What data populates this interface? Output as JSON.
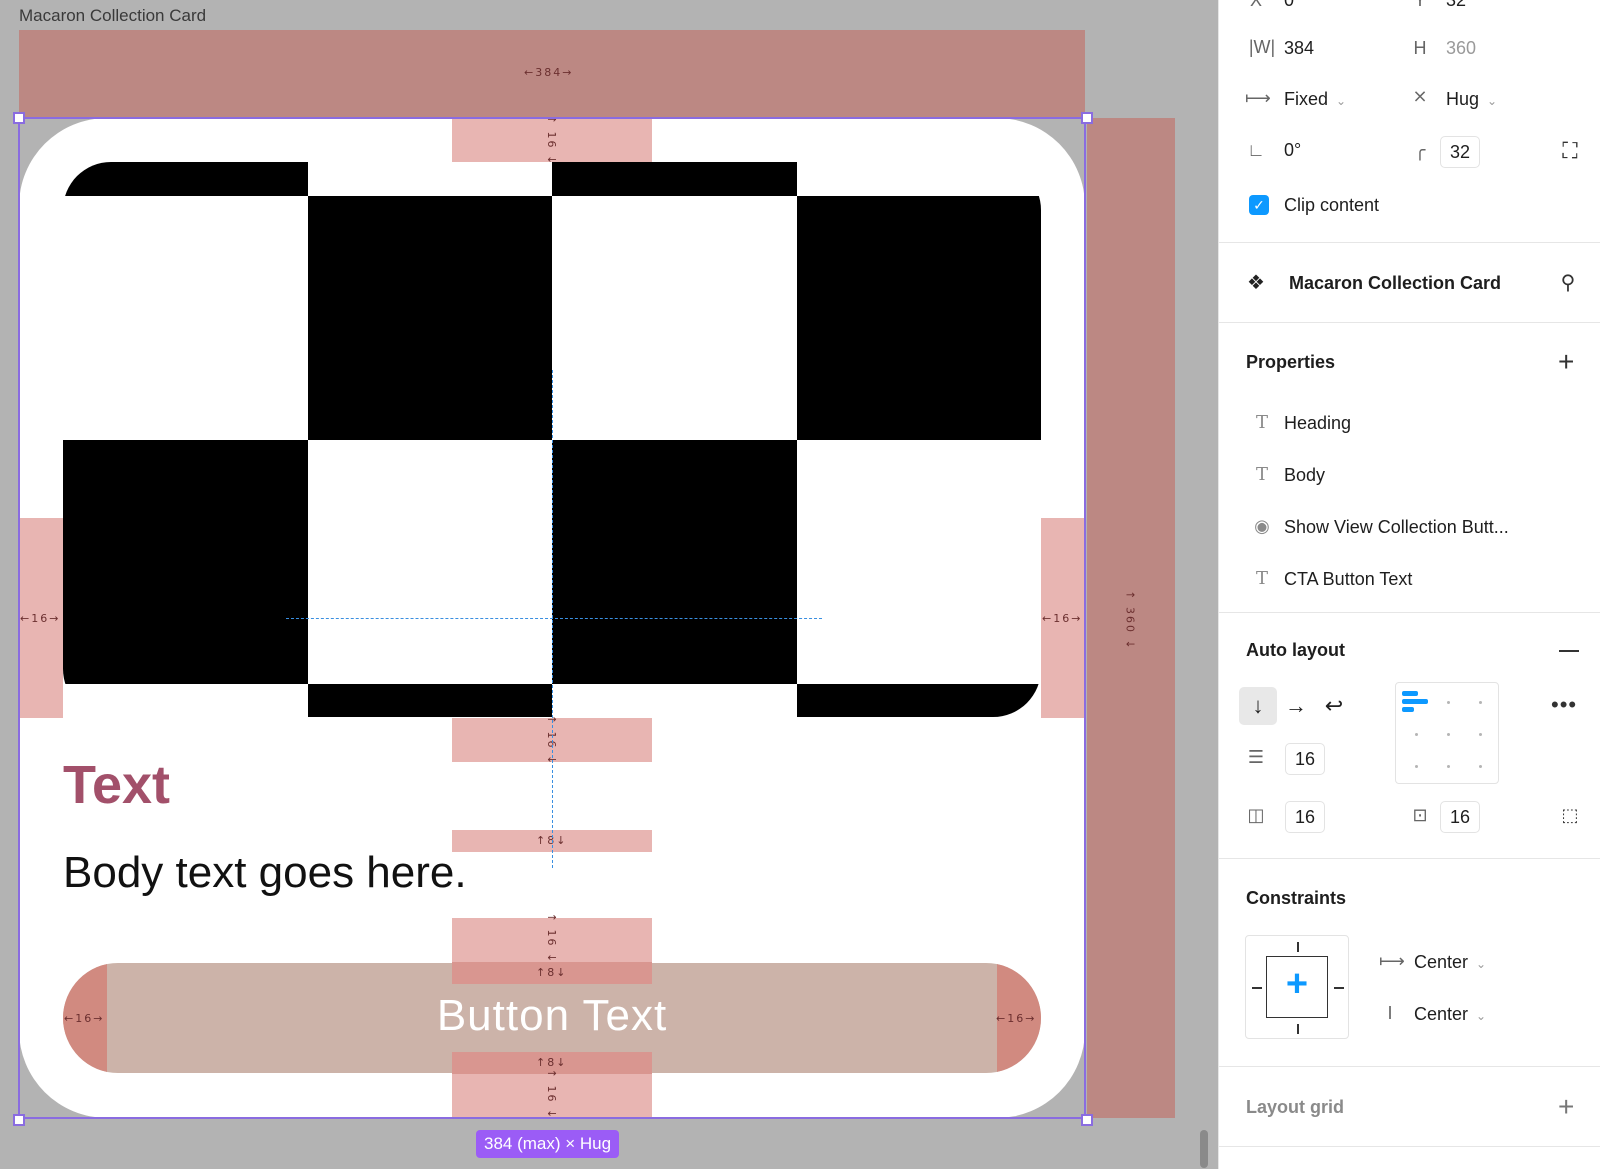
{
  "canvas": {
    "frame_name": "Macaron Collection Card",
    "measure_top": "←384→",
    "measure_pad": "16",
    "measure_gap": "8",
    "measure_left": "←16→",
    "measure_right": "←16→",
    "measure_height": "↑ 360 ↓",
    "measure_pad_vert": "↑ 16 ↓",
    "measure_gap_label": "↑8↓",
    "size_badge": "384 (max) × Hug",
    "card": {
      "heading": "Text",
      "body": "Body text goes here.",
      "cta_label": "Button Text"
    }
  },
  "panel": {
    "top_row": {
      "x_icon": "X",
      "x_value": "0",
      "y_icon": "Y",
      "y_value": "32"
    },
    "size": {
      "w_label": "|W|",
      "w_value": "384",
      "h_label": "H",
      "h_value": "360"
    },
    "resizing": {
      "horizontal": "Fixed",
      "vertical": "Hug"
    },
    "rotation": {
      "value": "0°",
      "radius": "32"
    },
    "clip_content": {
      "label": "Clip content",
      "checked": true
    },
    "component": {
      "name": "Macaron Collection Card"
    },
    "properties": {
      "title": "Properties",
      "items": [
        {
          "icon": "text-icon",
          "label": "Heading"
        },
        {
          "icon": "text-icon",
          "label": "Body"
        },
        {
          "icon": "eye-icon",
          "label": "Show View Collection Butt..."
        },
        {
          "icon": "text-icon",
          "label": "CTA Button Text"
        }
      ]
    },
    "auto_layout": {
      "title": "Auto layout",
      "gap": "16",
      "padding_horizontal": "16",
      "padding_vertical": "16"
    },
    "constraints": {
      "title": "Constraints",
      "horizontal": "Center",
      "vertical": "Center"
    },
    "layout_grid": {
      "title": "Layout grid"
    }
  },
  "colors": {
    "accent": "#0d99ff",
    "selection": "#8a6ce0",
    "heading": "#a2506a",
    "padding_band": "#bc8883",
    "padding_pink": "#e8b5b2"
  }
}
